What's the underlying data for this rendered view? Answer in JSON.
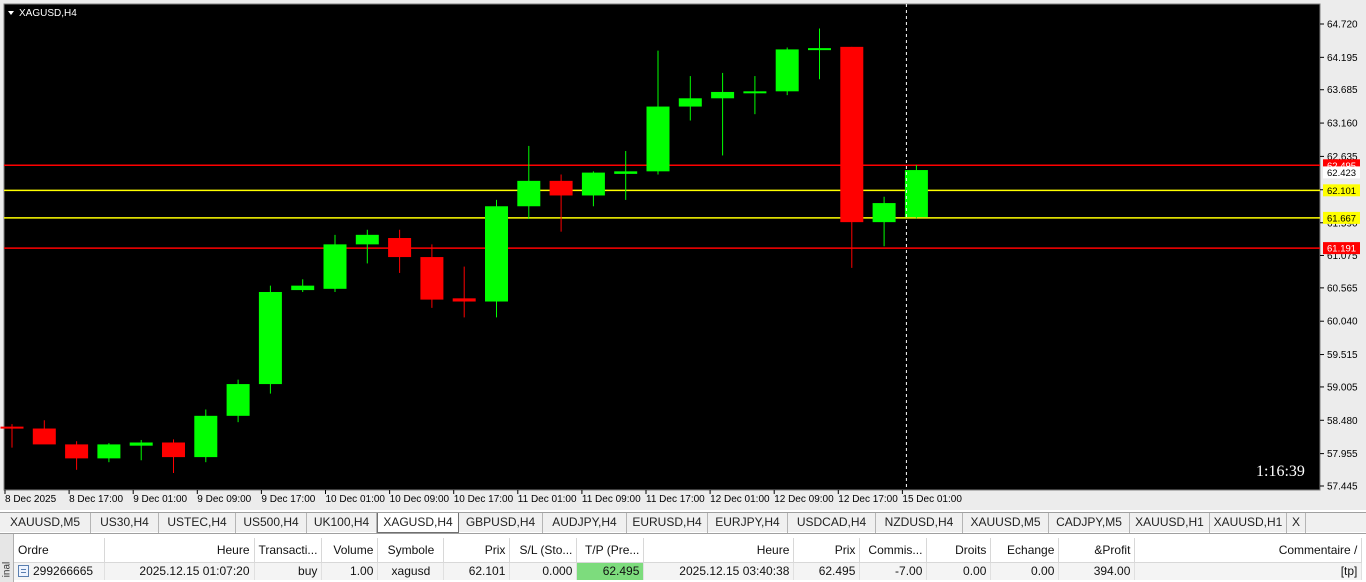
{
  "chart": {
    "title": "XAGUSD,H4",
    "countdown": "1:16:39",
    "price_ticks": [
      "64.720",
      "64.195",
      "63.685",
      "63.160",
      "62.635",
      "62.110",
      "61.590",
      "61.075",
      "60.565",
      "60.040",
      "59.515",
      "59.005",
      "58.480",
      "57.955",
      "57.445"
    ],
    "time_ticks": [
      "8 Dec 2025",
      "8 Dec 17:00",
      "9 Dec 01:00",
      "9 Dec 09:00",
      "9 Dec 17:00",
      "10 Dec 01:00",
      "10 Dec 09:00",
      "10 Dec 17:00",
      "11 Dec 01:00",
      "11 Dec 09:00",
      "11 Dec 17:00",
      "12 Dec 01:00",
      "12 Dec 09:00",
      "12 Dec 17:00",
      "15 Dec 01:00"
    ],
    "level_labels": {
      "tp": "62.495",
      "bid": "62.423",
      "open_price": "62.101",
      "lower_yellow": "61.667",
      "lower_red": "61.191"
    },
    "colors": {
      "bull": "#00ff00",
      "bear": "#ff0000",
      "red_line": "#ff0000",
      "yellow_line": "#ffff00",
      "background": "#000000"
    }
  },
  "chart_data": {
    "type": "candlestick",
    "title": "XAGUSD,H4",
    "ylim": [
      57.3,
      64.9
    ],
    "candles": [
      {
        "o": 58.38,
        "h": 58.42,
        "l": 58.05,
        "c": 58.35
      },
      {
        "o": 58.35,
        "h": 58.48,
        "l": 58.12,
        "c": 58.1
      },
      {
        "o": 58.1,
        "h": 58.15,
        "l": 57.7,
        "c": 57.88
      },
      {
        "o": 57.88,
        "h": 58.12,
        "l": 57.82,
        "c": 58.1
      },
      {
        "o": 58.08,
        "h": 58.17,
        "l": 57.85,
        "c": 58.13
      },
      {
        "o": 58.13,
        "h": 58.18,
        "l": 57.65,
        "c": 57.9
      },
      {
        "o": 57.9,
        "h": 58.65,
        "l": 57.82,
        "c": 58.55
      },
      {
        "o": 58.55,
        "h": 59.12,
        "l": 58.45,
        "c": 59.05
      },
      {
        "o": 59.05,
        "h": 60.6,
        "l": 58.9,
        "c": 60.5
      },
      {
        "o": 60.53,
        "h": 60.7,
        "l": 60.5,
        "c": 60.6
      },
      {
        "o": 60.55,
        "h": 61.4,
        "l": 60.5,
        "c": 61.25
      },
      {
        "o": 61.25,
        "h": 61.48,
        "l": 60.95,
        "c": 61.4
      },
      {
        "o": 61.35,
        "h": 61.48,
        "l": 60.8,
        "c": 61.05
      },
      {
        "o": 61.05,
        "h": 61.25,
        "l": 60.25,
        "c": 60.38
      },
      {
        "o": 60.4,
        "h": 60.9,
        "l": 60.1,
        "c": 60.35
      },
      {
        "o": 60.35,
        "h": 61.95,
        "l": 60.1,
        "c": 61.85
      },
      {
        "o": 61.85,
        "h": 62.8,
        "l": 61.65,
        "c": 62.25
      },
      {
        "o": 62.25,
        "h": 62.35,
        "l": 61.45,
        "c": 62.02
      },
      {
        "o": 62.02,
        "h": 62.4,
        "l": 61.85,
        "c": 62.38
      },
      {
        "o": 62.36,
        "h": 62.72,
        "l": 61.95,
        "c": 62.4
      },
      {
        "o": 62.4,
        "h": 64.3,
        "l": 62.35,
        "c": 63.42
      },
      {
        "o": 63.42,
        "h": 63.9,
        "l": 63.2,
        "c": 63.55
      },
      {
        "o": 63.55,
        "h": 63.95,
        "l": 62.65,
        "c": 63.65
      },
      {
        "o": 63.66,
        "h": 63.9,
        "l": 63.3,
        "c": 63.66
      },
      {
        "o": 63.66,
        "h": 64.35,
        "l": 63.6,
        "c": 64.32
      },
      {
        "o": 64.33,
        "h": 64.65,
        "l": 63.85,
        "c": 64.34
      },
      {
        "o": 64.36,
        "h": 64.36,
        "l": 60.88,
        "c": 61.6
      },
      {
        "o": 61.6,
        "h": 62.0,
        "l": 61.22,
        "c": 61.9
      },
      {
        "o": 61.68,
        "h": 62.5,
        "l": 61.66,
        "c": 62.42
      }
    ],
    "hlines": [
      {
        "price": 62.495,
        "color": "red"
      },
      {
        "price": 62.101,
        "color": "yellow"
      },
      {
        "price": 61.667,
        "color": "yellow"
      },
      {
        "price": 61.191,
        "color": "red"
      }
    ],
    "vline_time_index": 28
  },
  "tabs": [
    "XAUUSD,M5",
    "US30,H4",
    "USTEC,H4",
    "US500,H4",
    "UK100,H4",
    "XAGUSD,H4",
    "GBPUSD,H4",
    "AUDJPY,H4",
    "EURUSD,H4",
    "EURJPY,H4",
    "USDCAD,H4",
    "NZDUSD,H4",
    "XAUUSD,M5",
    "CADJPY,M5",
    "XAUUSD,H1",
    "XAUUSD,H1",
    "X"
  ],
  "active_tab": "XAGUSD,H4",
  "terminal": {
    "side_label": "inal",
    "columns": [
      "Ordre",
      "Heure",
      "Transacti...",
      "Volume",
      "Symbole",
      "Prix",
      "S/L (Sto...",
      "T/P (Pre...",
      "Heure",
      "Prix",
      "Commis...",
      "Droits",
      "Echange",
      "&Profit",
      "Commentaire"
    ],
    "sort_indicator": "/",
    "rows": [
      {
        "order": "299266665",
        "open_time": "2025.12.15 01:07:20",
        "type": "buy",
        "volume": "1.00",
        "symbol": "xagusd",
        "price": "62.101",
        "sl": "0.000",
        "tp": "62.495",
        "close_time": "2025.12.15 03:40:38",
        "close_price": "62.495",
        "commission": "-7.00",
        "swap": "0.00",
        "exchange": "0.00",
        "profit": "394.00",
        "comment": "[tp]"
      }
    ]
  }
}
